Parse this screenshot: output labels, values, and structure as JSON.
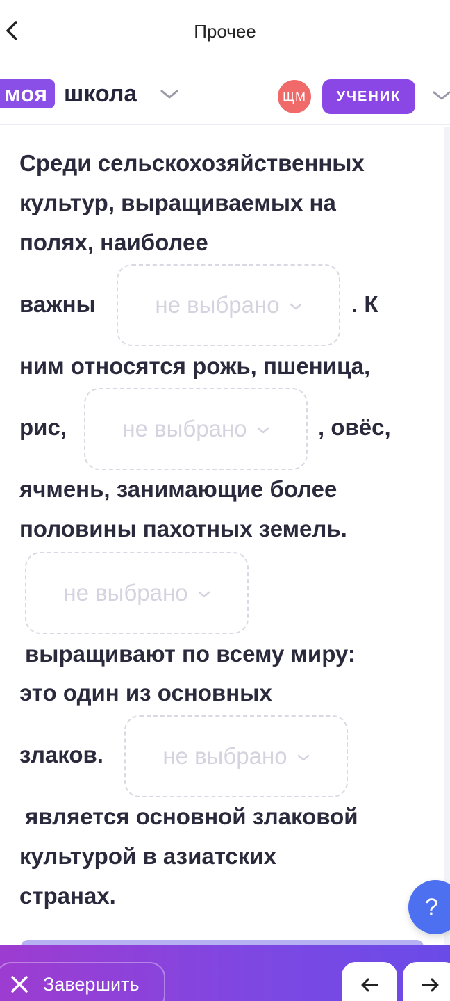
{
  "header": {
    "title": "Прочее"
  },
  "brand": {
    "part1": "моя",
    "part2": "школа"
  },
  "user": {
    "initials": "ЩМ",
    "role": "УЧЕНИК"
  },
  "task": {
    "lines": [
      "Среди сельскохозяйственных",
      "культур, выращиваемых на",
      "полях, наиболее",
      "важны",
      ". К",
      "ним относятся рожь, пшеница,",
      "рис,",
      ", овёс,",
      "ячмень, занимающие более",
      "половины пахотных земель.",
      "выращивают по всему миру:",
      "это один из основных",
      "злаков.",
      "является основной злаковой",
      "культурой в азиатских",
      "странах."
    ],
    "dropdowns": [
      {
        "value": "не выбрано"
      },
      {
        "value": "не выбрано"
      },
      {
        "value": "не выбрано"
      },
      {
        "value": "не выбрано"
      }
    ]
  },
  "help": {
    "label": "?"
  },
  "footer": {
    "finish_label": "Завершить"
  },
  "colors": {
    "accent": "#8a47e6",
    "avatar": "#f06a6a",
    "help": "#4d70f0",
    "placeholder": "#d4d3df"
  },
  "icons": [
    "back-chevron-icon",
    "chevron-down-icon",
    "close-icon",
    "arrow-left-icon",
    "arrow-right-icon"
  ]
}
